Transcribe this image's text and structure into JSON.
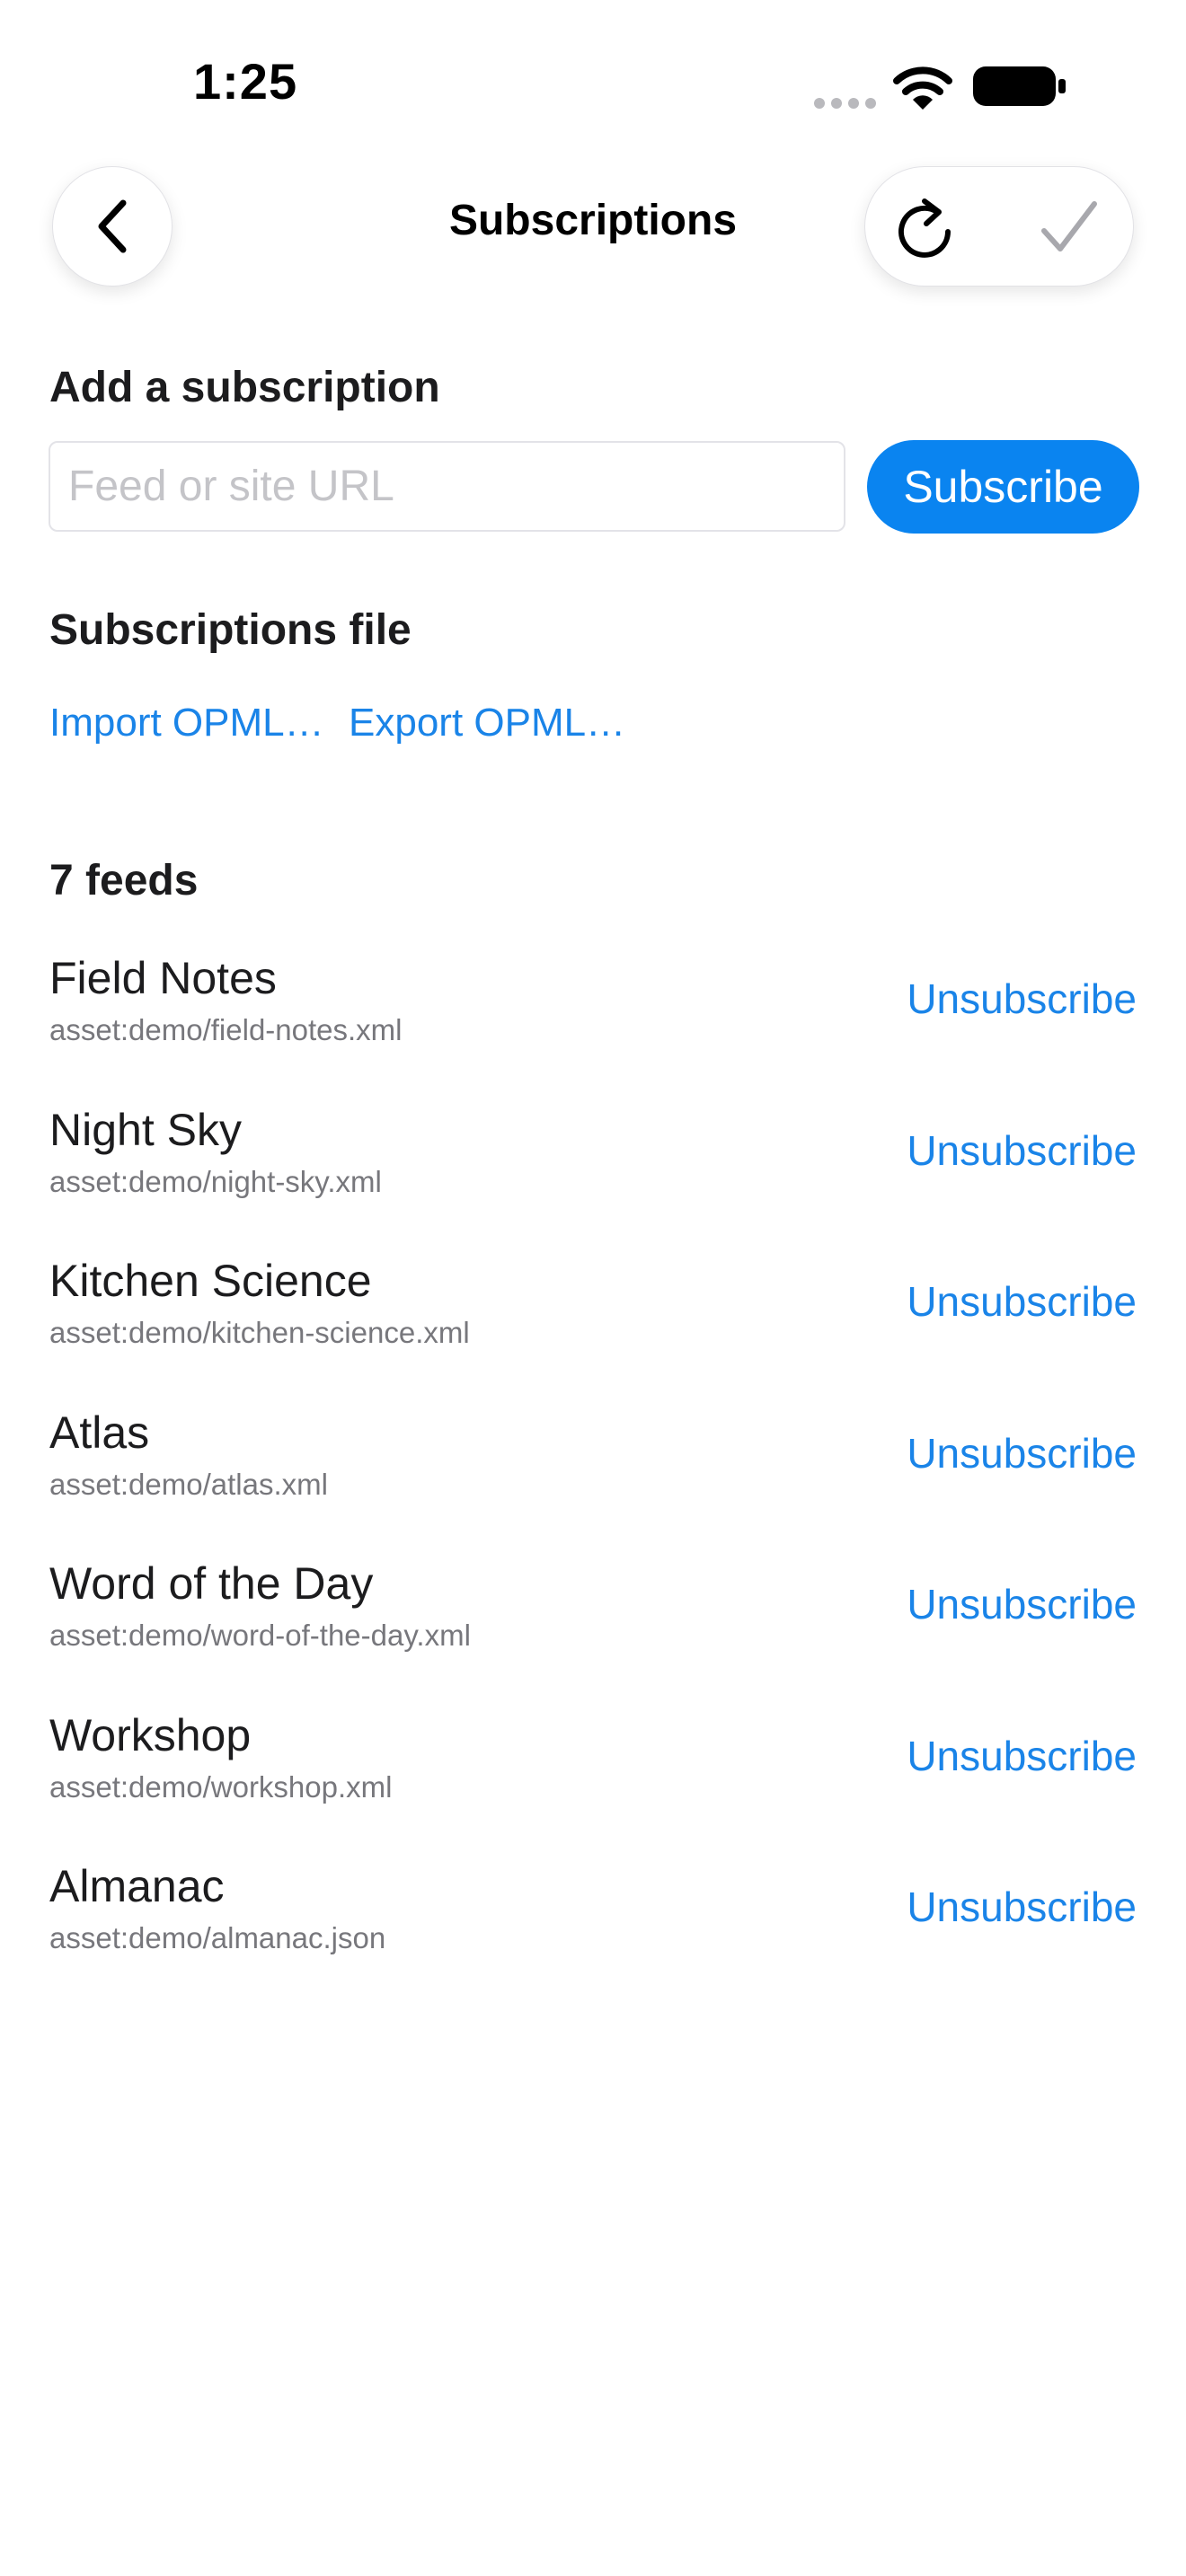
{
  "status_bar": {
    "time": "1:25",
    "icons": [
      "signal-dots-icon",
      "wifi-icon",
      "battery-icon"
    ]
  },
  "nav": {
    "title": "Subscriptions",
    "back_icon": "chevron-left-icon",
    "refresh_icon": "refresh-icon",
    "done_icon": "checkmark-icon"
  },
  "add_subscription": {
    "heading": "Add a subscription",
    "placeholder": "Feed or site URL",
    "value": "",
    "button_label": "Subscribe"
  },
  "subscriptions_file": {
    "heading": "Subscriptions file",
    "import_label": "Import OPML…",
    "export_label": "Export OPML…"
  },
  "feeds": {
    "count_label": "7 feeds",
    "unsubscribe_label": "Unsubscribe",
    "items": [
      {
        "title": "Field Notes",
        "url": "asset:demo/field-notes.xml"
      },
      {
        "title": "Night Sky",
        "url": "asset:demo/night-sky.xml"
      },
      {
        "title": "Kitchen Science",
        "url": "asset:demo/kitchen-science.xml"
      },
      {
        "title": "Atlas",
        "url": "asset:demo/atlas.xml"
      },
      {
        "title": "Word of the Day",
        "url": "asset:demo/word-of-the-day.xml"
      },
      {
        "title": "Workshop",
        "url": "asset:demo/workshop.xml"
      },
      {
        "title": "Almanac",
        "url": "asset:demo/almanac.json"
      }
    ]
  },
  "colors": {
    "accent": "#0a84f0",
    "link": "#1a84e8",
    "text": "#1c1c1e",
    "secondary_text": "#77777c",
    "placeholder": "#c4c4c8",
    "disabled_icon": "#a8a8ad"
  }
}
